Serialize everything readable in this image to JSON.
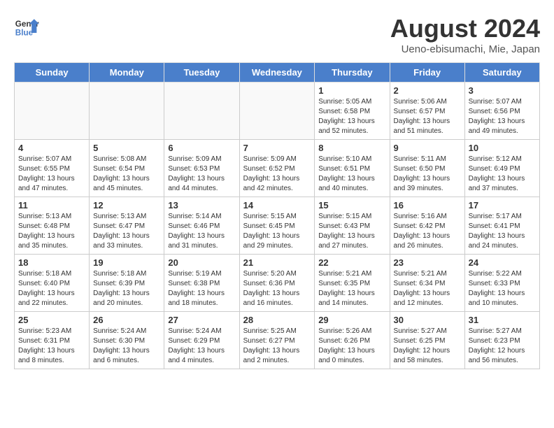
{
  "header": {
    "logo_line1": "General",
    "logo_line2": "Blue",
    "title": "August 2024",
    "subtitle": "Ueno-ebisumachi, Mie, Japan"
  },
  "weekdays": [
    "Sunday",
    "Monday",
    "Tuesday",
    "Wednesday",
    "Thursday",
    "Friday",
    "Saturday"
  ],
  "weeks": [
    [
      {
        "day": "",
        "info": ""
      },
      {
        "day": "",
        "info": ""
      },
      {
        "day": "",
        "info": ""
      },
      {
        "day": "",
        "info": ""
      },
      {
        "day": "1",
        "info": "Sunrise: 5:05 AM\nSunset: 6:58 PM\nDaylight: 13 hours\nand 52 minutes."
      },
      {
        "day": "2",
        "info": "Sunrise: 5:06 AM\nSunset: 6:57 PM\nDaylight: 13 hours\nand 51 minutes."
      },
      {
        "day": "3",
        "info": "Sunrise: 5:07 AM\nSunset: 6:56 PM\nDaylight: 13 hours\nand 49 minutes."
      }
    ],
    [
      {
        "day": "4",
        "info": "Sunrise: 5:07 AM\nSunset: 6:55 PM\nDaylight: 13 hours\nand 47 minutes."
      },
      {
        "day": "5",
        "info": "Sunrise: 5:08 AM\nSunset: 6:54 PM\nDaylight: 13 hours\nand 45 minutes."
      },
      {
        "day": "6",
        "info": "Sunrise: 5:09 AM\nSunset: 6:53 PM\nDaylight: 13 hours\nand 44 minutes."
      },
      {
        "day": "7",
        "info": "Sunrise: 5:09 AM\nSunset: 6:52 PM\nDaylight: 13 hours\nand 42 minutes."
      },
      {
        "day": "8",
        "info": "Sunrise: 5:10 AM\nSunset: 6:51 PM\nDaylight: 13 hours\nand 40 minutes."
      },
      {
        "day": "9",
        "info": "Sunrise: 5:11 AM\nSunset: 6:50 PM\nDaylight: 13 hours\nand 39 minutes."
      },
      {
        "day": "10",
        "info": "Sunrise: 5:12 AM\nSunset: 6:49 PM\nDaylight: 13 hours\nand 37 minutes."
      }
    ],
    [
      {
        "day": "11",
        "info": "Sunrise: 5:13 AM\nSunset: 6:48 PM\nDaylight: 13 hours\nand 35 minutes."
      },
      {
        "day": "12",
        "info": "Sunrise: 5:13 AM\nSunset: 6:47 PM\nDaylight: 13 hours\nand 33 minutes."
      },
      {
        "day": "13",
        "info": "Sunrise: 5:14 AM\nSunset: 6:46 PM\nDaylight: 13 hours\nand 31 minutes."
      },
      {
        "day": "14",
        "info": "Sunrise: 5:15 AM\nSunset: 6:45 PM\nDaylight: 13 hours\nand 29 minutes."
      },
      {
        "day": "15",
        "info": "Sunrise: 5:15 AM\nSunset: 6:43 PM\nDaylight: 13 hours\nand 27 minutes."
      },
      {
        "day": "16",
        "info": "Sunrise: 5:16 AM\nSunset: 6:42 PM\nDaylight: 13 hours\nand 26 minutes."
      },
      {
        "day": "17",
        "info": "Sunrise: 5:17 AM\nSunset: 6:41 PM\nDaylight: 13 hours\nand 24 minutes."
      }
    ],
    [
      {
        "day": "18",
        "info": "Sunrise: 5:18 AM\nSunset: 6:40 PM\nDaylight: 13 hours\nand 22 minutes."
      },
      {
        "day": "19",
        "info": "Sunrise: 5:18 AM\nSunset: 6:39 PM\nDaylight: 13 hours\nand 20 minutes."
      },
      {
        "day": "20",
        "info": "Sunrise: 5:19 AM\nSunset: 6:38 PM\nDaylight: 13 hours\nand 18 minutes."
      },
      {
        "day": "21",
        "info": "Sunrise: 5:20 AM\nSunset: 6:36 PM\nDaylight: 13 hours\nand 16 minutes."
      },
      {
        "day": "22",
        "info": "Sunrise: 5:21 AM\nSunset: 6:35 PM\nDaylight: 13 hours\nand 14 minutes."
      },
      {
        "day": "23",
        "info": "Sunrise: 5:21 AM\nSunset: 6:34 PM\nDaylight: 13 hours\nand 12 minutes."
      },
      {
        "day": "24",
        "info": "Sunrise: 5:22 AM\nSunset: 6:33 PM\nDaylight: 13 hours\nand 10 minutes."
      }
    ],
    [
      {
        "day": "25",
        "info": "Sunrise: 5:23 AM\nSunset: 6:31 PM\nDaylight: 13 hours\nand 8 minutes."
      },
      {
        "day": "26",
        "info": "Sunrise: 5:24 AM\nSunset: 6:30 PM\nDaylight: 13 hours\nand 6 minutes."
      },
      {
        "day": "27",
        "info": "Sunrise: 5:24 AM\nSunset: 6:29 PM\nDaylight: 13 hours\nand 4 minutes."
      },
      {
        "day": "28",
        "info": "Sunrise: 5:25 AM\nSunset: 6:27 PM\nDaylight: 13 hours\nand 2 minutes."
      },
      {
        "day": "29",
        "info": "Sunrise: 5:26 AM\nSunset: 6:26 PM\nDaylight: 13 hours\nand 0 minutes."
      },
      {
        "day": "30",
        "info": "Sunrise: 5:27 AM\nSunset: 6:25 PM\nDaylight: 12 hours\nand 58 minutes."
      },
      {
        "day": "31",
        "info": "Sunrise: 5:27 AM\nSunset: 6:23 PM\nDaylight: 12 hours\nand 56 minutes."
      }
    ]
  ]
}
